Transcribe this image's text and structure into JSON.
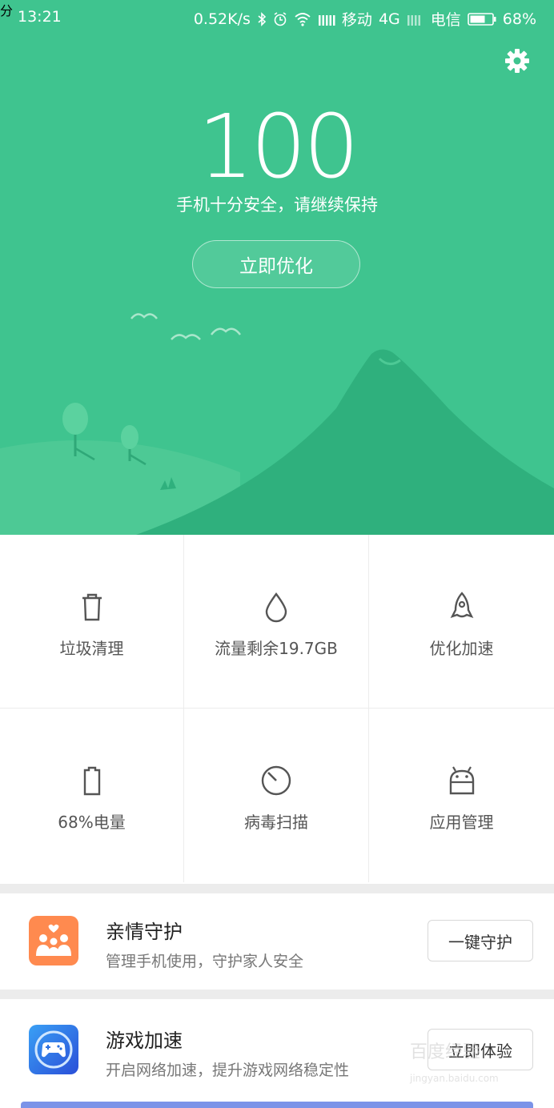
{
  "status_bar": {
    "time": "13:21",
    "speed": "0.52K/s",
    "carrier1": "移动",
    "network": "4G",
    "carrier2": "电信",
    "battery": "68%"
  },
  "hero": {
    "score": "100",
    "unit": "分",
    "subtitle": "手机十分安全，请继续保持",
    "optimize_button": "立即优化"
  },
  "tools": [
    {
      "label": "垃圾清理",
      "icon": "trash-icon"
    },
    {
      "label": "流量剩余19.7GB",
      "icon": "water-drop-icon"
    },
    {
      "label": "优化加速",
      "icon": "rocket-icon"
    },
    {
      "label": "68%电量",
      "icon": "battery-icon"
    },
    {
      "label": "病毒扫描",
      "icon": "scan-dial-icon"
    },
    {
      "label": "应用管理",
      "icon": "android-icon"
    }
  ],
  "cards": [
    {
      "title": "亲情守护",
      "desc": "管理手机使用，守护家人安全",
      "button": "一键守护",
      "icon": "family-icon"
    },
    {
      "title": "游戏加速",
      "desc": "开启网络加速，提升游戏网络稳定性",
      "button": "立即体验",
      "icon": "gamepad-icon"
    }
  ],
  "watermark": {
    "text": "百度经验",
    "url": "jingyan.baidu.com"
  },
  "colors": {
    "hero_green": "#3fc48f",
    "mountain_green": "#2fb07d",
    "family_orange": "#ff8a4f",
    "game_blue": "#2a6fe0"
  }
}
